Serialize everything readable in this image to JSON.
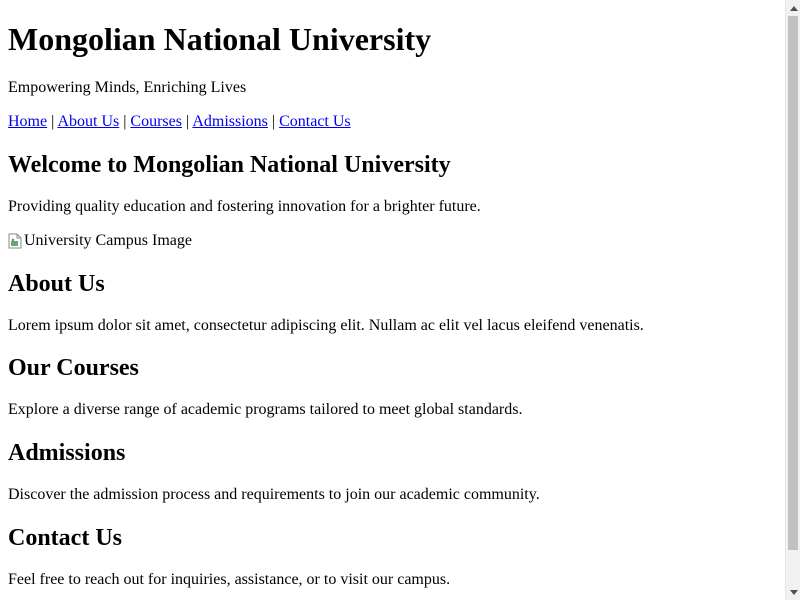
{
  "header": {
    "title": "Mongolian National University",
    "tagline": "Empowering Minds, Enriching Lives"
  },
  "nav": {
    "separator": "|",
    "items": [
      {
        "label": "Home"
      },
      {
        "label": "About Us"
      },
      {
        "label": "Courses"
      },
      {
        "label": "Admissions"
      },
      {
        "label": "Contact Us"
      }
    ]
  },
  "welcome": {
    "heading": "Welcome to Mongolian National University",
    "text": "Providing quality education and fostering innovation for a brighter future.",
    "image_alt": "University Campus Image",
    "image_icon": "broken-image-icon"
  },
  "about": {
    "heading": "About Us",
    "text": "Lorem ipsum dolor sit amet, consectetur adipiscing elit. Nullam ac elit vel lacus eleifend venenatis."
  },
  "courses": {
    "heading": "Our Courses",
    "text": "Explore a diverse range of academic programs tailored to meet global standards."
  },
  "admissions": {
    "heading": "Admissions",
    "text": "Discover the admission process and requirements to join our academic community."
  },
  "contact": {
    "heading": "Contact Us",
    "text": "Feel free to reach out for inquiries, assistance, or to visit our campus."
  },
  "colors": {
    "link": "#0000ee",
    "scrollbar_track": "#f1f1f1",
    "scrollbar_thumb": "#c1c1c1"
  }
}
